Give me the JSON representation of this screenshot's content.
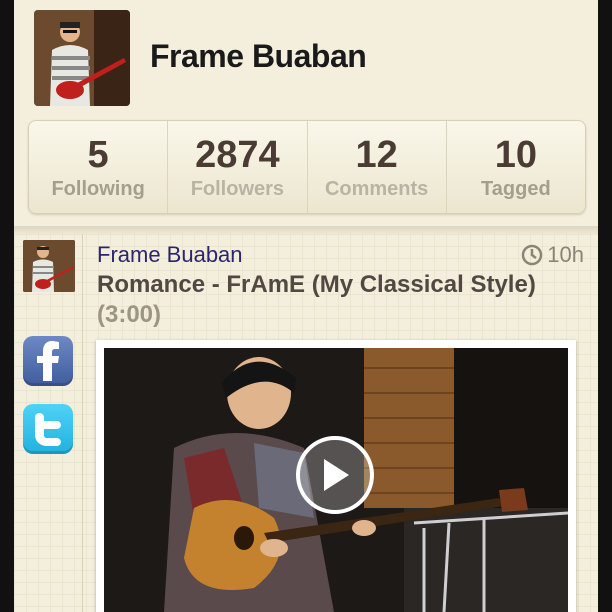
{
  "profile": {
    "name": "Frame Buaban"
  },
  "stats": [
    {
      "value": "5",
      "label": "Following"
    },
    {
      "value": "2874",
      "label": "Followers"
    },
    {
      "value": "12",
      "label": "Comments"
    },
    {
      "value": "10",
      "label": "Tagged"
    }
  ],
  "post": {
    "author": "Frame Buaban",
    "time": "10h",
    "title": "Romance - FrAmE (My Classical Style)",
    "duration": "(3:00)"
  },
  "icons": {
    "facebook": "facebook-icon",
    "twitter": "twitter-icon",
    "clock": "clock-icon",
    "play": "play-icon"
  },
  "colors": {
    "background": "#f3efdc",
    "author_link": "#2b2570",
    "facebook": "#3f5d9c",
    "twitter": "#22b1e0"
  }
}
